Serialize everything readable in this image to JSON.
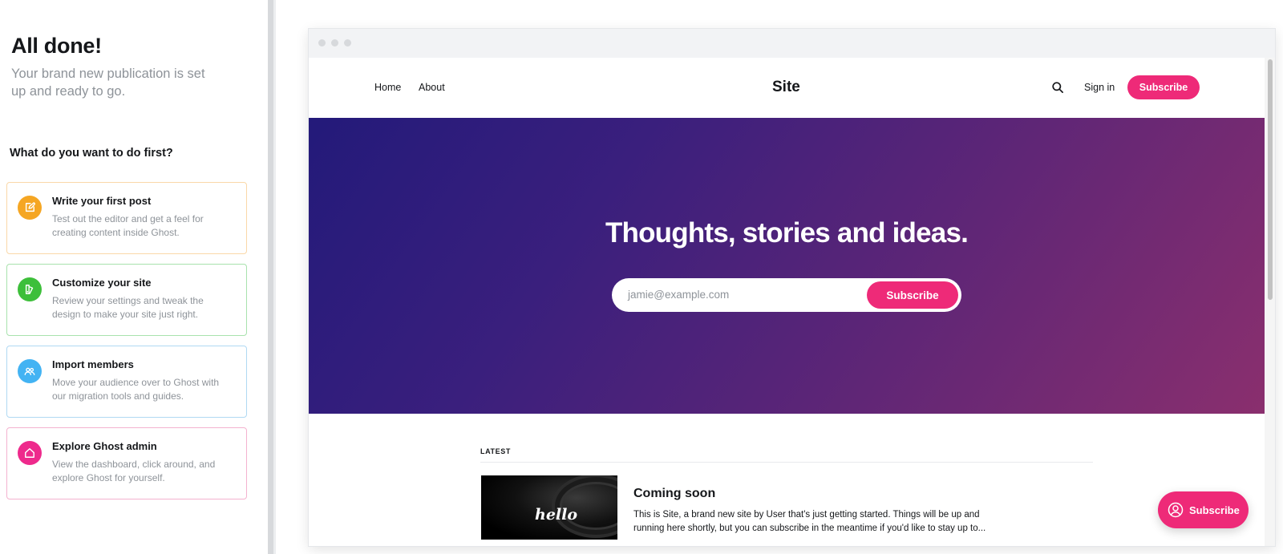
{
  "onboarding": {
    "title": "All done!",
    "subtitle": "Your brand new publication is set up and ready to go.",
    "question": "What do you want to do first?",
    "cards": [
      {
        "title": "Write your first post",
        "description": "Test out the editor and get a feel for creating content inside Ghost.",
        "icon": "pencil-edit-icon",
        "color": "#f5a623"
      },
      {
        "title": "Customize your site",
        "description": "Review your settings and tweak the design to make your site just right.",
        "icon": "paintbrush-icon",
        "color": "#3dbf3a"
      },
      {
        "title": "Import members",
        "description": "Move your audience over to Ghost with our migration tools and guides.",
        "icon": "members-icon",
        "color": "#43b3f3"
      },
      {
        "title": "Explore Ghost admin",
        "description": "View the dashboard, click around, and explore Ghost for yourself.",
        "icon": "home-icon",
        "color": "#ee2a8c"
      }
    ]
  },
  "site": {
    "nav": {
      "home": "Home",
      "about": "About",
      "title": "Site",
      "signin": "Sign in",
      "subscribe": "Subscribe"
    },
    "hero": {
      "title": "Thoughts, stories and ideas.",
      "email_placeholder": "jamie@example.com",
      "subscribe": "Subscribe"
    },
    "latest_label": "LATEST",
    "post": {
      "thumbnail_text": "hello",
      "title": "Coming soon",
      "excerpt": "This is Site, a brand new site by User that's just getting started. Things will be up and running here shortly, but you can subscribe in the meantime if you'd like to stay up to..."
    },
    "floating_subscribe": "Subscribe"
  },
  "colors": {
    "accent": "#ee2a78",
    "hero_start": "#231a7a",
    "hero_end": "#8a2f6e"
  }
}
